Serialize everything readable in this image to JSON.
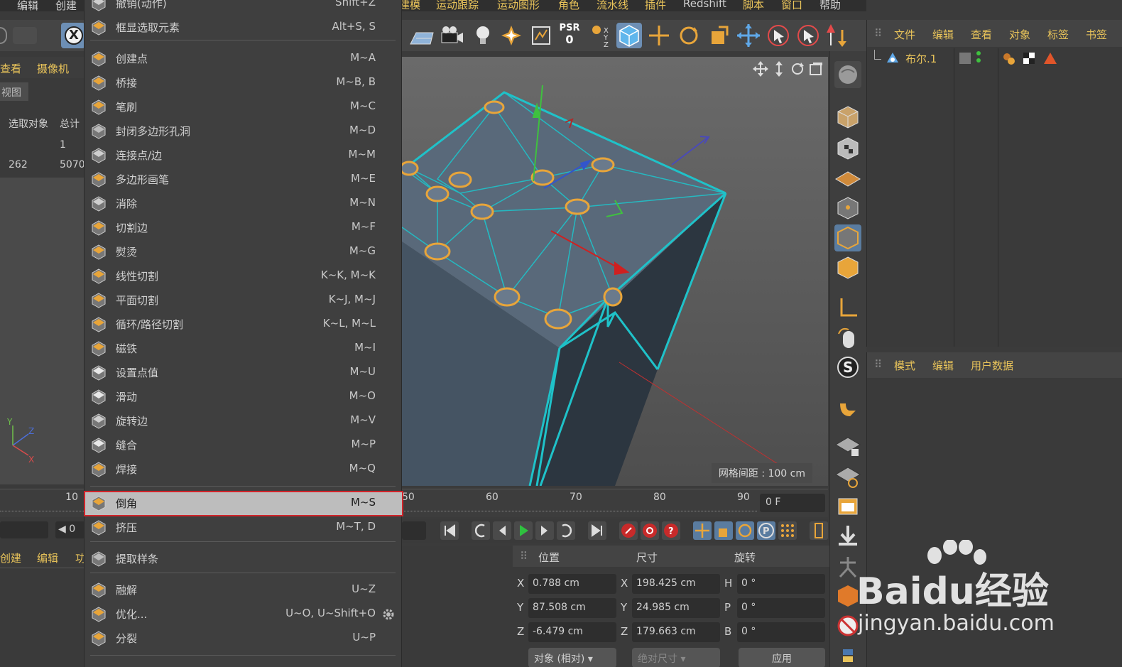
{
  "left_panel": {
    "menubar": [
      "编辑",
      "创建"
    ],
    "tabs": [
      "查看",
      "摄像机"
    ],
    "view_label": "视图",
    "stats": {
      "headers": [
        "选取对象",
        "总计"
      ],
      "row1": [
        "",
        "1"
      ],
      "row2": [
        "262",
        "5070"
      ]
    },
    "axis": {
      "y": "Y",
      "z": "Z",
      "x": "X"
    },
    "timeline_number": "10",
    "field_value": "0",
    "bottom_tabs": [
      "创建",
      "编辑",
      "功"
    ]
  },
  "menu": {
    "items": [
      {
        "label": "撤销(动作)",
        "shortcut": "Shift+Z",
        "icon": "undo-icon"
      },
      {
        "label": "框显选取元素",
        "shortcut": "Alt+S, S",
        "icon": "frame-selection-icon"
      },
      {
        "label": "创建点",
        "shortcut": "M~A",
        "icon": "create-point-icon"
      },
      {
        "label": "桥接",
        "shortcut": "M~B, B",
        "icon": "bridge-icon"
      },
      {
        "label": "笔刷",
        "shortcut": "M~C",
        "icon": "brush-icon"
      },
      {
        "label": "封闭多边形孔洞",
        "shortcut": "M~D",
        "icon": "close-hole-icon"
      },
      {
        "label": "连接点/边",
        "shortcut": "M~M",
        "icon": "connect-icon"
      },
      {
        "label": "多边形画笔",
        "shortcut": "M~E",
        "icon": "polygon-pen-icon"
      },
      {
        "label": "消除",
        "shortcut": "M~N",
        "icon": "dissolve-icon"
      },
      {
        "label": "切割边",
        "shortcut": "M~F",
        "icon": "edge-cut-icon"
      },
      {
        "label": "熨烫",
        "shortcut": "M~G",
        "icon": "iron-icon"
      },
      {
        "label": "线性切割",
        "shortcut": "K~K, M~K",
        "icon": "knife-icon"
      },
      {
        "label": "平面切割",
        "shortcut": "K~J, M~J",
        "icon": "plane-cut-icon"
      },
      {
        "label": "循环/路径切割",
        "shortcut": "K~L, M~L",
        "icon": "loop-cut-icon"
      },
      {
        "label": "磁铁",
        "shortcut": "M~I",
        "icon": "magnet-icon"
      },
      {
        "label": "设置点值",
        "shortcut": "M~U",
        "icon": "set-point-value-icon"
      },
      {
        "label": "滑动",
        "shortcut": "M~O",
        "icon": "slide-icon"
      },
      {
        "label": "旋转边",
        "shortcut": "M~V",
        "icon": "spin-edge-icon"
      },
      {
        "label": "缝合",
        "shortcut": "M~P",
        "icon": "stitch-icon"
      },
      {
        "label": "焊接",
        "shortcut": "M~Q",
        "icon": "weld-icon"
      },
      {
        "label": "倒角",
        "shortcut": "M~S",
        "icon": "bevel-icon"
      },
      {
        "label": "挤压",
        "shortcut": "M~T, D",
        "icon": "extrude-icon"
      },
      {
        "label": "提取样条",
        "shortcut": "",
        "icon": "extract-spline-icon"
      },
      {
        "label": "融解",
        "shortcut": "U~Z",
        "icon": "melt-icon"
      },
      {
        "label": "优化...",
        "shortcut": "U~O, U~Shift+O",
        "icon": "optimize-icon"
      },
      {
        "label": "分裂",
        "shortcut": "U~P",
        "icon": "split-icon"
      }
    ]
  },
  "top_menubar": {
    "items": [
      "建模",
      "运动跟踪",
      "运动图形",
      "角色",
      "流水线",
      "插件",
      "Redshift",
      "脚本",
      "窗口",
      "帮助"
    ]
  },
  "toolbar": {
    "psr_label": "PSR",
    "psr_value": "0"
  },
  "viewport": {
    "grid_spacing": "网格间距 : 100 cm"
  },
  "object_manager": {
    "header": [
      "文件",
      "编辑",
      "查看",
      "对象",
      "标签",
      "书签"
    ],
    "object_name": "布尔.1"
  },
  "attributes": {
    "header": [
      "模式",
      "编辑",
      "用户数据"
    ]
  },
  "timeline": {
    "ticks": [
      "50",
      "60",
      "70",
      "80",
      "90"
    ],
    "frame": "0 F"
  },
  "coordinates": {
    "headers": [
      "位置",
      "尺寸",
      "旋转"
    ],
    "rows": [
      {
        "axis": "X",
        "pos": "0.788 cm",
        "size_axis": "X",
        "size": "198.425 cm",
        "rot_axis": "H",
        "rot": "0 °"
      },
      {
        "axis": "Y",
        "pos": "87.508 cm",
        "size_axis": "Y",
        "size": "24.985 cm",
        "rot_axis": "P",
        "rot": "0 °"
      },
      {
        "axis": "Z",
        "pos": "-6.479 cm",
        "size_axis": "Z",
        "size": "179.663 cm",
        "rot_axis": "B",
        "rot": "0 °"
      }
    ],
    "mode_dropdown": "对象 (相对)",
    "size_dropdown": "绝对尺寸",
    "apply_button": "应用"
  },
  "watermark": {
    "brand": "Bai",
    "brand2": "du",
    "brand_suffix": "经验",
    "url": "jingyan.baidu.com"
  },
  "colors": {
    "accent_orange": "#e8a53a",
    "wire_cyan": "#1fc2c9",
    "highlight_red": "#d0242a"
  }
}
